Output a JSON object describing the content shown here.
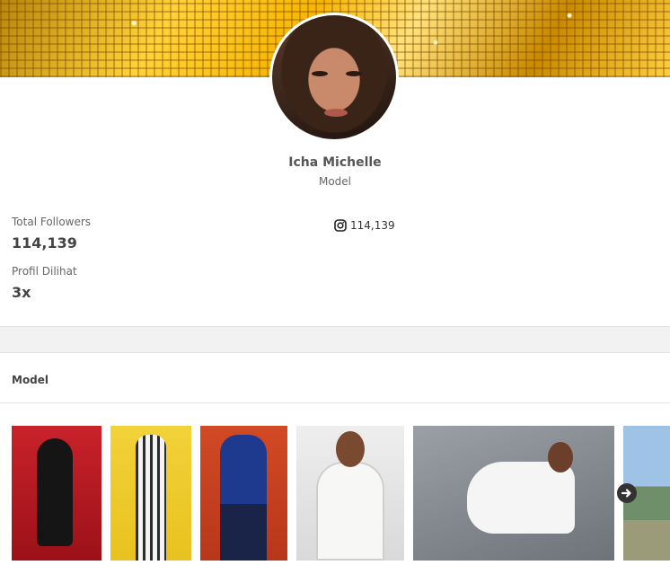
{
  "profile": {
    "name": "Icha Michelle",
    "role": "Model"
  },
  "stats": {
    "followers_label": "Total Followers",
    "followers_value": "114,139",
    "views_label": "Profil Dilihat",
    "views_value": "3x"
  },
  "social": {
    "icon": "instagram-icon",
    "instagram_count": "114,139"
  },
  "gallery": {
    "section_title": "Model",
    "next_icon": "arrow-right-icon",
    "photos": [
      {
        "alt": "photo-1"
      },
      {
        "alt": "photo-2"
      },
      {
        "alt": "photo-3"
      },
      {
        "alt": "photo-4"
      },
      {
        "alt": "photo-5"
      },
      {
        "alt": "photo-6"
      }
    ]
  },
  "colors": {
    "cover_gold": "#f7b500",
    "text": "#555555",
    "band": "#f2f2f2"
  }
}
